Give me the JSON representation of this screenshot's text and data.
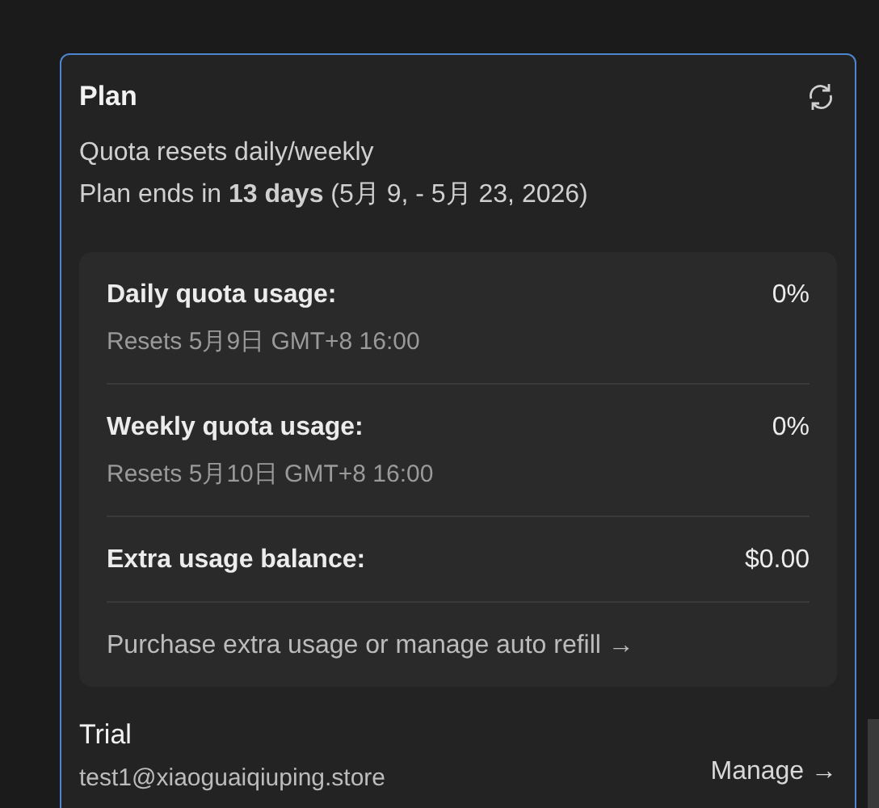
{
  "plan": {
    "title": "Plan",
    "subtitle": "Quota resets daily/weekly",
    "ends": "Plan ends in **13 days** (5月 9, - 5月 23, 2026)",
    "usage": [
      {
        "kind": "quota",
        "label": "Daily quota usage:",
        "value": "0%",
        "note": "Resets 5月9日 GMT+8 16:00"
      },
      {
        "kind": "quota",
        "label": "Weekly quota usage:",
        "value": "0%",
        "note": "Resets 5月10日 GMT+8 16:00"
      },
      {
        "kind": "balance",
        "label": "Extra usage balance:",
        "value": "$0.00"
      },
      {
        "kind": "link",
        "label": "Purchase extra usage or manage auto refill →"
      }
    ]
  },
  "trial": {
    "title": "Trial",
    "email": "test1@xiaoguaiqiuping.store",
    "manage": "Manage →"
  }
}
